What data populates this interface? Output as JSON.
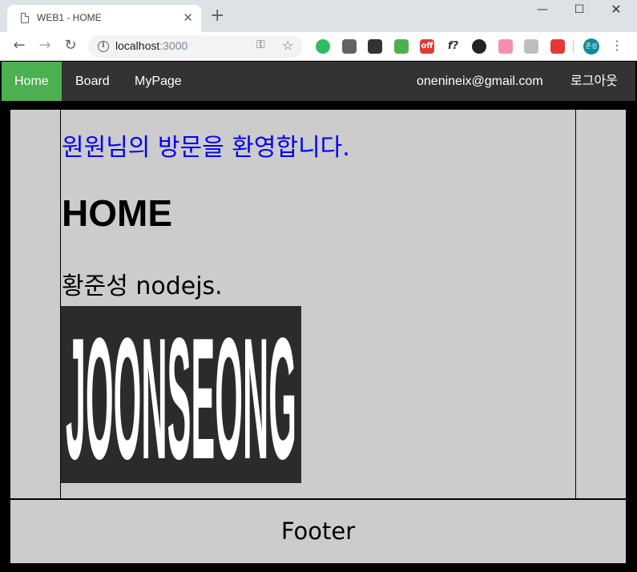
{
  "browser": {
    "tab_title": "WEB1 - HOME",
    "url_host": "localhost",
    "url_port": ":3000",
    "window_controls": [
      "minimize-icon",
      "maximize-icon",
      "close-icon"
    ],
    "extensions": [
      {
        "name": "evernote-icon",
        "color": "#2dbe60"
      },
      {
        "name": "chat-icon",
        "color": "#5f6368"
      },
      {
        "name": "incognito-icon",
        "color": "#333333"
      },
      {
        "name": "eyedropper-icon",
        "color": "#4caf50"
      },
      {
        "name": "off-badge-icon",
        "color": "#e53935",
        "text": "off"
      },
      {
        "name": "font-icon",
        "color": "#333333",
        "text": "f?"
      },
      {
        "name": "color-wheel-icon",
        "color": "#222222"
      },
      {
        "name": "arrow-ext-icon",
        "color": "#f48fb1"
      },
      {
        "name": "pin-ext-icon",
        "color": "#bdbdbd"
      },
      {
        "name": "sync-ext-icon",
        "color": "#e53935"
      }
    ],
    "profile_text": "준성"
  },
  "nav": {
    "items": [
      {
        "label": "Home",
        "active": true
      },
      {
        "label": "Board",
        "active": false
      },
      {
        "label": "MyPage",
        "active": false
      }
    ],
    "email": "onenineix@gmail.com",
    "logout": "로그아웃",
    "bar_color": "#333333",
    "active_color": "#4caf50"
  },
  "main": {
    "welcome": "원원님의 방문을 환영합니다.",
    "welcome_color": "#0000ff",
    "heading": "HOME",
    "description": "황준성 nodejs.",
    "logo_text": "JOONSEONG"
  },
  "footer": {
    "text": "Footer"
  },
  "colors": {
    "panel_bg": "#cccccc",
    "page_bg": "#000000"
  }
}
